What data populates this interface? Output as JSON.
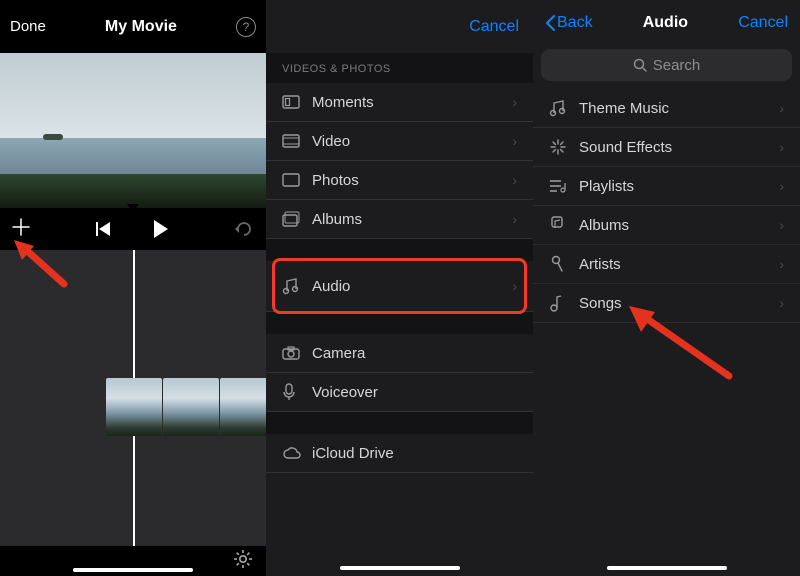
{
  "panel1": {
    "done": "Done",
    "title": "My Movie",
    "help_glyph": "?"
  },
  "panel2": {
    "cancel": "Cancel",
    "section_title": "VIDEOS & PHOTOS",
    "rows_a": [
      {
        "icon": "moments",
        "label": "Moments"
      },
      {
        "icon": "video",
        "label": "Video"
      },
      {
        "icon": "photos",
        "label": "Photos"
      },
      {
        "icon": "albums",
        "label": "Albums"
      }
    ],
    "audio": {
      "icon": "audio",
      "label": "Audio"
    },
    "rows_b": [
      {
        "icon": "camera",
        "label": "Camera"
      },
      {
        "icon": "voiceover",
        "label": "Voiceover"
      }
    ],
    "rows_c": [
      {
        "icon": "icloud",
        "label": "iCloud Drive"
      }
    ]
  },
  "panel3": {
    "back": "Back",
    "title": "Audio",
    "cancel": "Cancel",
    "search_placeholder": "Search",
    "rows": [
      {
        "icon": "music",
        "label": "Theme Music"
      },
      {
        "icon": "burst",
        "label": "Sound Effects"
      },
      {
        "icon": "playlist",
        "label": "Playlists"
      },
      {
        "icon": "album",
        "label": "Albums"
      },
      {
        "icon": "mic",
        "label": "Artists"
      },
      {
        "icon": "songs",
        "label": "Songs"
      }
    ]
  }
}
